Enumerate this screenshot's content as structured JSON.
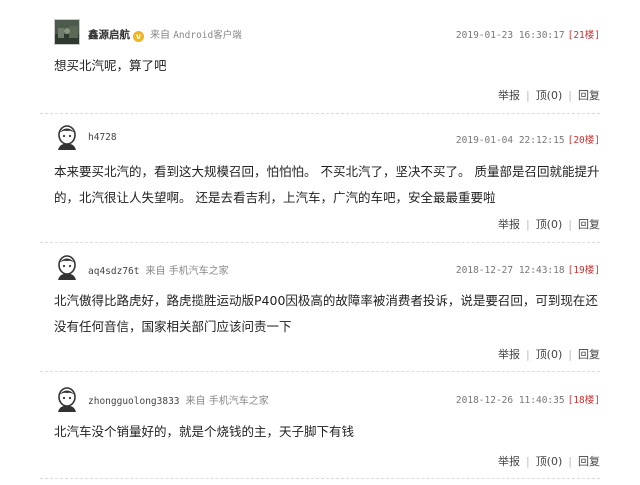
{
  "comments": [
    {
      "username": "鑫源启航",
      "from": "来自",
      "device": "Android客户端",
      "time": "2019-01-23 16:30:17",
      "floor": "[21楼]",
      "text": "想买北汽呢，算了吧",
      "actions": {
        "report": "举报",
        "upvote": "顶(0)",
        "reply": "回复"
      }
    },
    {
      "username": "h4728",
      "time": "2019-01-04 22:12:15",
      "floor": "[20楼]",
      "text": "本来要买北汽的，看到这大规模召回，怕怕怕。 不买北汽了，坚决不买了。 质量部是召回就能提升的，北汽很让人失望啊。 还是去看吉利，上汽车，广汽的车吧，安全最最重要啦",
      "actions": {
        "report": "举报",
        "upvote": "顶(0)",
        "reply": "回复"
      }
    },
    {
      "username": "aq4sdz76t",
      "from": "来自",
      "device": "手机汽车之家",
      "time": "2018-12-27 12:43:18",
      "floor": "[19楼]",
      "text": "北汽傲得比路虎好，路虎揽胜运动版P400因极高的故障率被消费者投诉，说是要召回，可到现在还没有任何音信，国家相关部门应该问责一下",
      "actions": {
        "report": "举报",
        "upvote": "顶(0)",
        "reply": "回复"
      }
    },
    {
      "username": "zhongguolong3833",
      "from": "来自",
      "device": "手机汽车之家",
      "time": "2018-12-26 11:40:35",
      "floor": "[18楼]",
      "text": "北汽车没个销量好的，就是个烧钱的主，天子脚下有钱",
      "actions": {
        "report": "举报",
        "upvote": "顶(0)",
        "reply": "回复"
      }
    }
  ],
  "colors": {
    "floor": "#cc3333",
    "badge": "#f2b51e"
  },
  "icons": {
    "verified": "v-badge-icon",
    "default_avatar": "default-avatar-icon"
  }
}
